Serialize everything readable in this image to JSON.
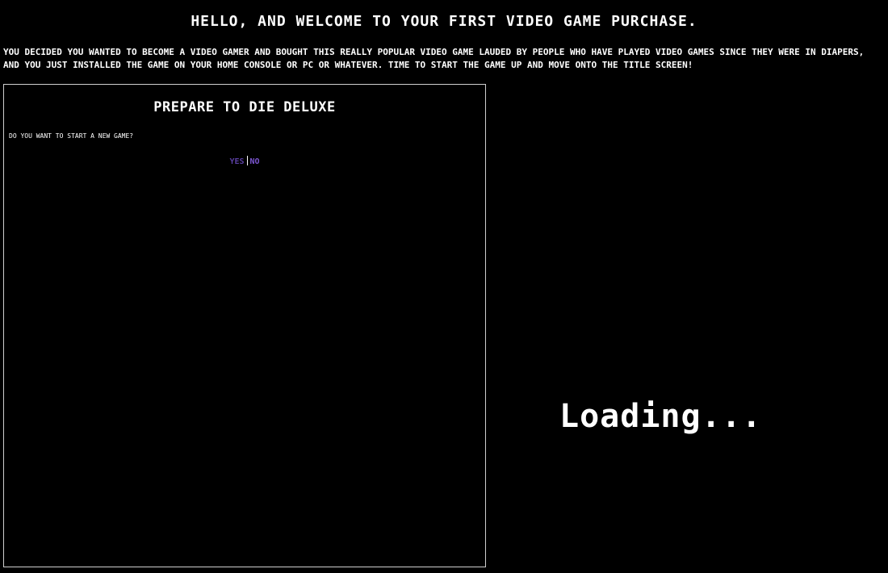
{
  "headline": "HELLO, AND WELCOME TO YOUR FIRST VIDEO GAME PURCHASE.",
  "intro": "YOU DECIDED YOU WANTED TO BECOME A VIDEO GAMER AND BOUGHT THIS REALLY POPULAR VIDEO GAME LAUDED BY PEOPLE WHO HAVE PLAYED VIDEO GAMES SINCE THEY WERE IN DIAPERS, AND YOU JUST INSTALLED THE GAME ON YOUR HOME CONSOLE OR PC OR WHATEVER. TIME TO START THE GAME UP AND MOVE ONTO THE TITLE SCREEN!",
  "game_window": {
    "title": "PREPARE TO DIE DELUXE",
    "question": "DO YOU WANT TO START A NEW GAME?",
    "choices": {
      "yes_label": "YES",
      "no_label": "NO"
    }
  },
  "loading_text": "Loading...",
  "colors": {
    "background": "#000000",
    "text": "#ffffff",
    "choice_yes": "#5a3fa2",
    "choice_no": "#7a55cf",
    "window_border": "#cfcfcf"
  }
}
